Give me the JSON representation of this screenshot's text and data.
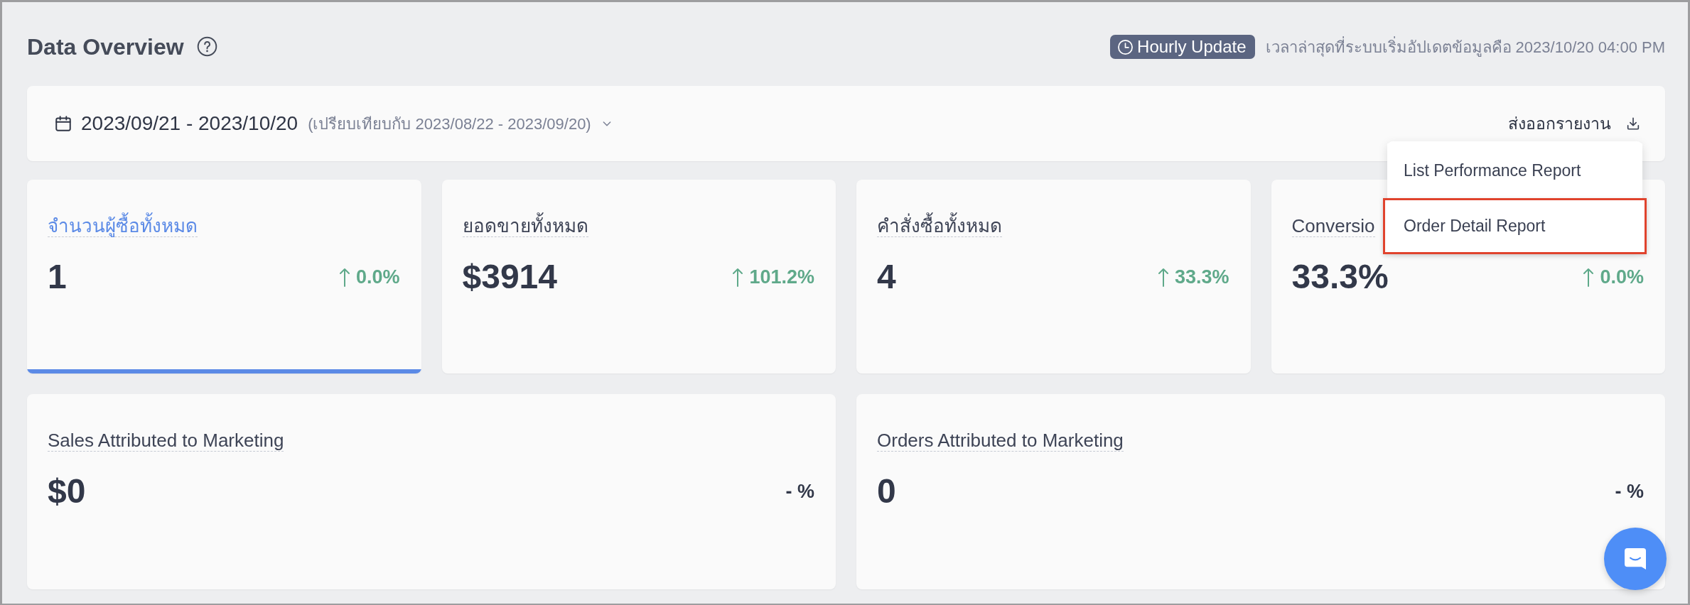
{
  "header": {
    "title": "Data Overview",
    "update_badge": "Hourly Update",
    "last_update": "เวลาล่าสุดที่ระบบเริ่มอัปเดตข้อมูลคือ 2023/10/20 04:00 PM"
  },
  "date_bar": {
    "range": "2023/09/21 - 2023/10/20",
    "comparison": "(เปรียบเทียบกับ 2023/08/22 - 2023/09/20)",
    "export_label": "ส่งออกรายงาน"
  },
  "export_menu": {
    "expanded": true,
    "items": [
      {
        "label": "List Performance Report",
        "selected": false
      },
      {
        "label": "Order Detail Report",
        "selected": true
      }
    ]
  },
  "metrics": [
    {
      "label": "จำนวนผู้ซื้อทั้งหมด",
      "value": "1",
      "rising": true,
      "change": "0.0%",
      "selected": true
    },
    {
      "label": "ยอดขายทั้งหมด",
      "value": "$3914",
      "rising": true,
      "change": "101.2%",
      "selected": false
    },
    {
      "label": "คำสั่งซื้อทั้งหมด",
      "value": "4",
      "rising": true,
      "change": "33.3%",
      "selected": false
    },
    {
      "label": "Conversio",
      "value": "33.3%",
      "rising": true,
      "change": "0.0%",
      "selected": false
    }
  ],
  "attribution": [
    {
      "label": "Sales Attributed to Marketing",
      "value": "$0",
      "change": "- %"
    },
    {
      "label": "Orders Attributed to Marketing",
      "value": "0",
      "change": "- %"
    }
  ]
}
